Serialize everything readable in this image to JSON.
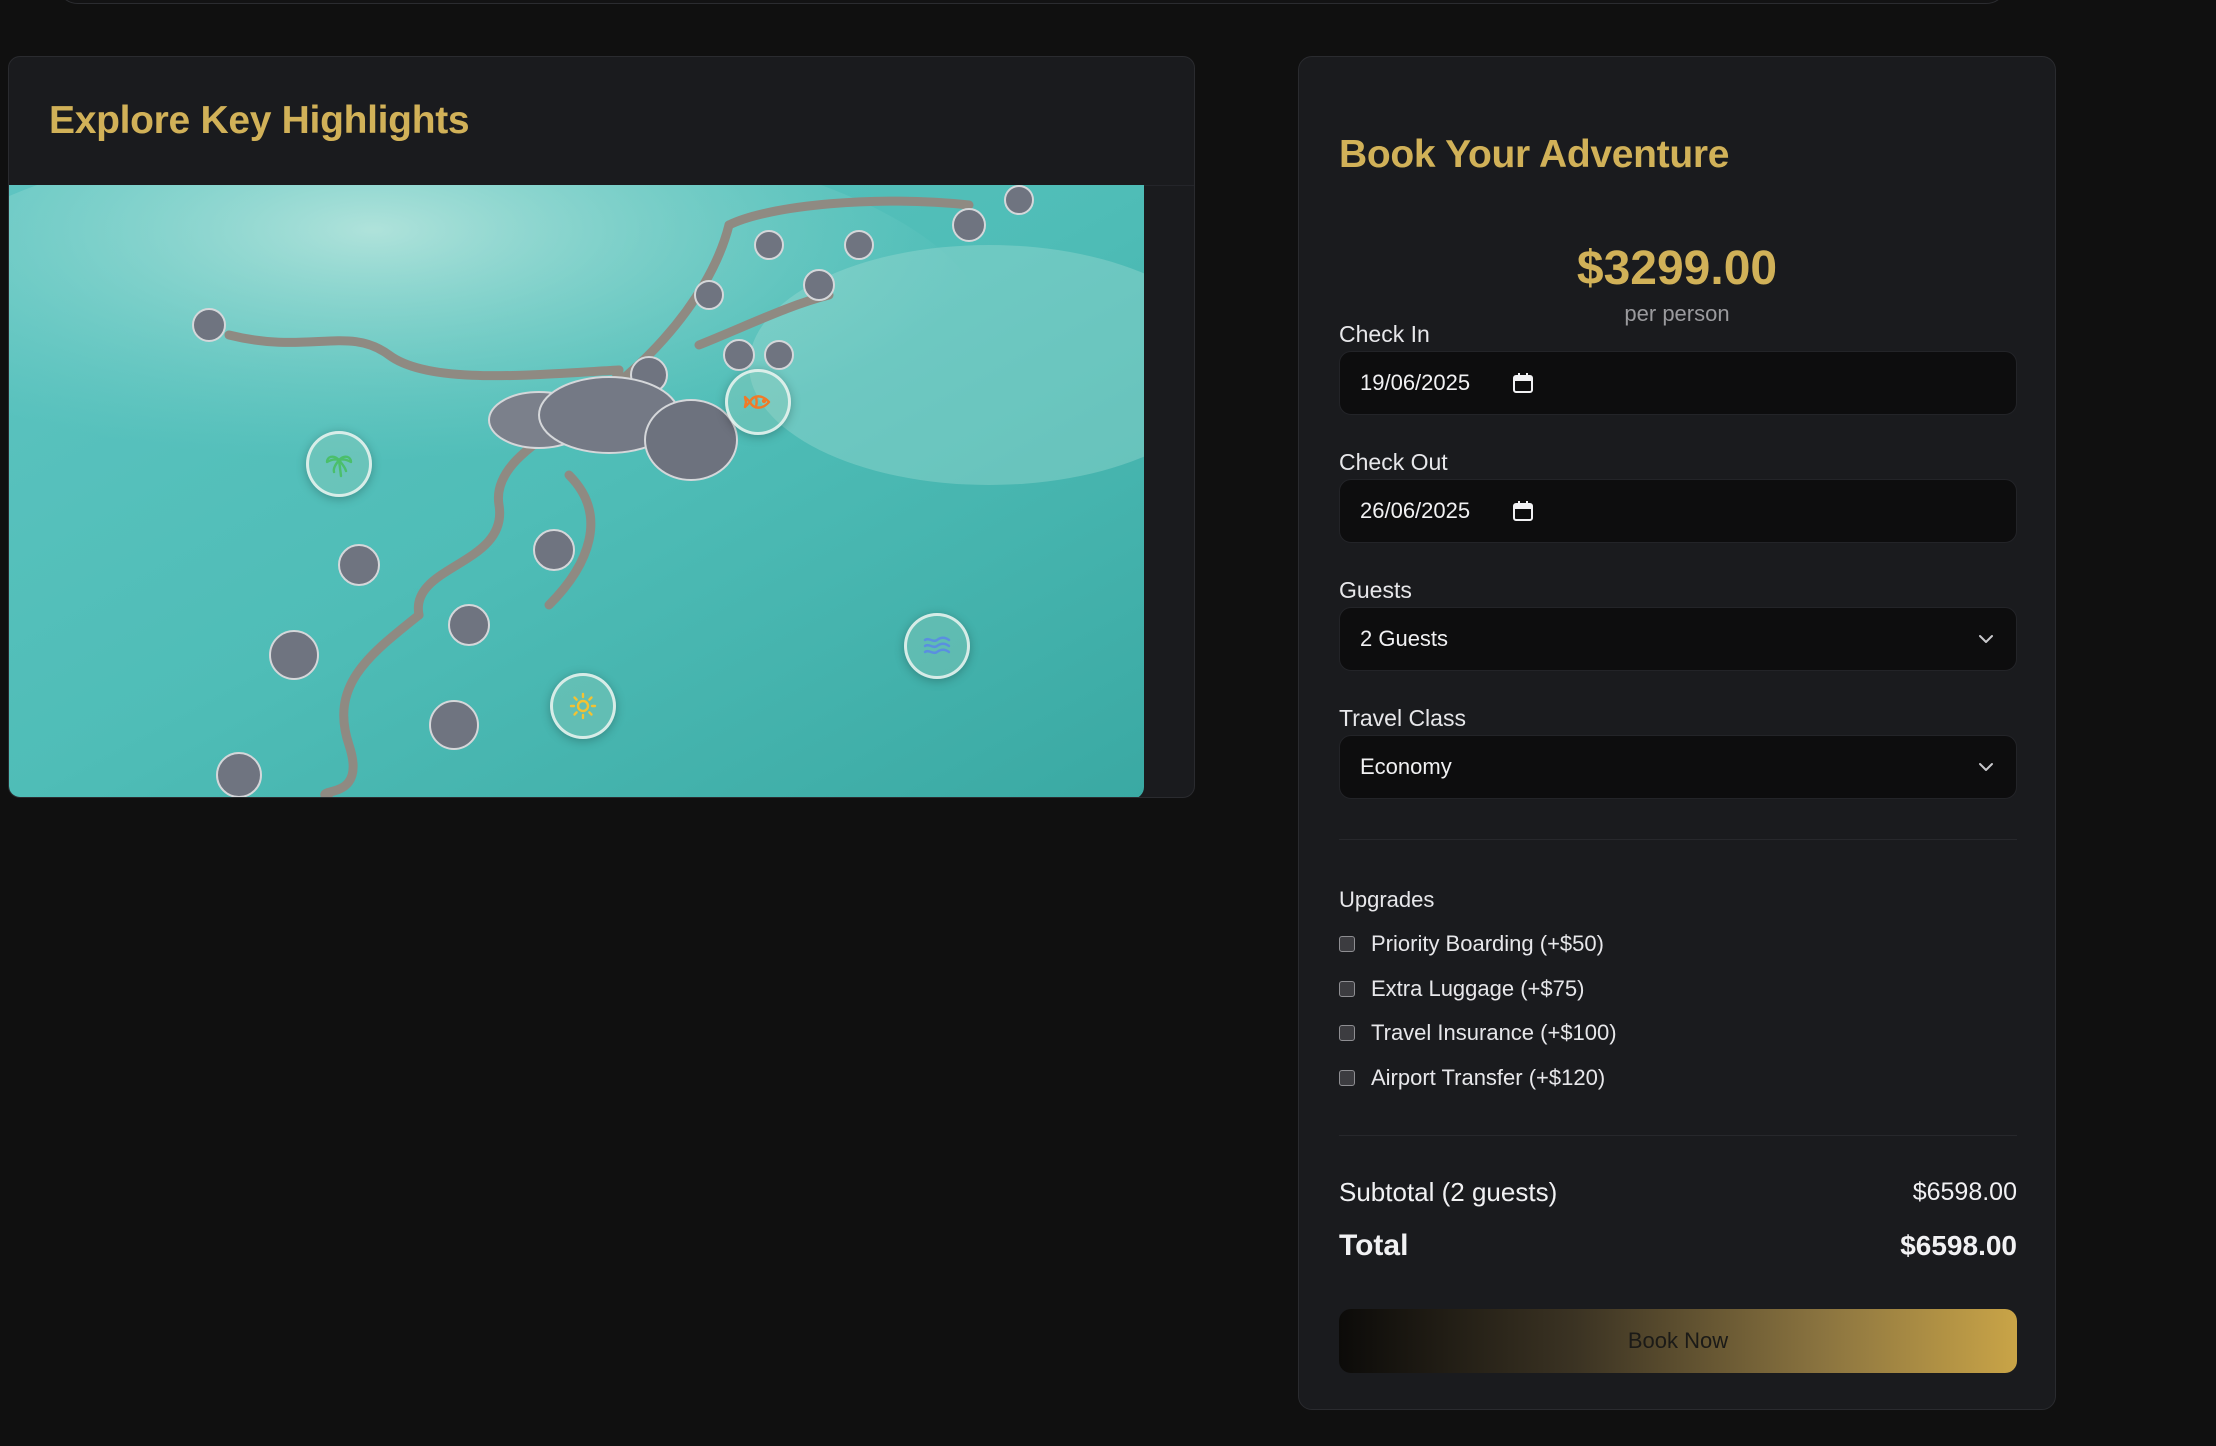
{
  "highlights": {
    "title": "Explore Key Highlights",
    "hotspots": [
      {
        "icon": "palm-tree-icon",
        "color": "#4bbf6b"
      },
      {
        "icon": "fish-icon",
        "color": "#f07a28"
      },
      {
        "icon": "sun-icon",
        "color": "#f2c233"
      },
      {
        "icon": "waves-icon",
        "color": "#5a8fe0"
      }
    ]
  },
  "booking": {
    "title": "Book Your Adventure",
    "price": "$3299.00",
    "price_unit": "per person",
    "check_in": {
      "label": "Check In",
      "value": "19/06/2025"
    },
    "check_out": {
      "label": "Check Out",
      "value": "26/06/2025"
    },
    "guests": {
      "label": "Guests",
      "value": "2 Guests"
    },
    "travel_class": {
      "label": "Travel Class",
      "value": "Economy"
    },
    "upgrades": {
      "label": "Upgrades",
      "items": [
        {
          "label": "Priority Boarding (+$50)",
          "checked": false
        },
        {
          "label": "Extra Luggage (+$75)",
          "checked": false
        },
        {
          "label": "Travel Insurance (+$100)",
          "checked": false
        },
        {
          "label": "Airport Transfer (+$120)",
          "checked": false
        }
      ]
    },
    "subtotal": {
      "label": "Subtotal (2 guests)",
      "value": "$6598.00"
    },
    "total": {
      "label": "Total",
      "value": "$6598.00"
    },
    "button": "Book Now"
  },
  "colors": {
    "accent_gold": "#d1b158",
    "background": "#101010",
    "card": "#1a1b1e"
  }
}
